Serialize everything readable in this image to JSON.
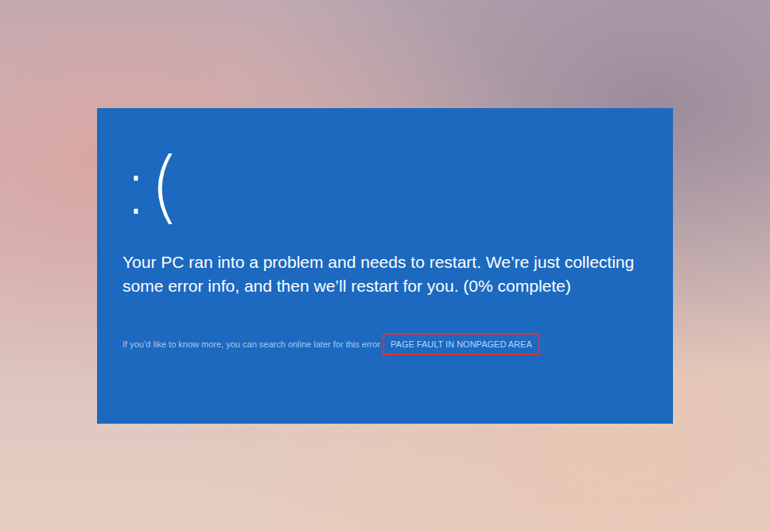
{
  "screen": {
    "face": ":(",
    "message": "Your PC ran into a problem and needs to restart. We’re just collecting some error info, and then we’ll restart for you. (0% complete)",
    "hint": "If you’d like to know more, you can search online later for this error",
    "error_code": {
      "text": "PAGE FAULT IN NONPAGED AREA",
      "highlighted": true
    }
  }
}
